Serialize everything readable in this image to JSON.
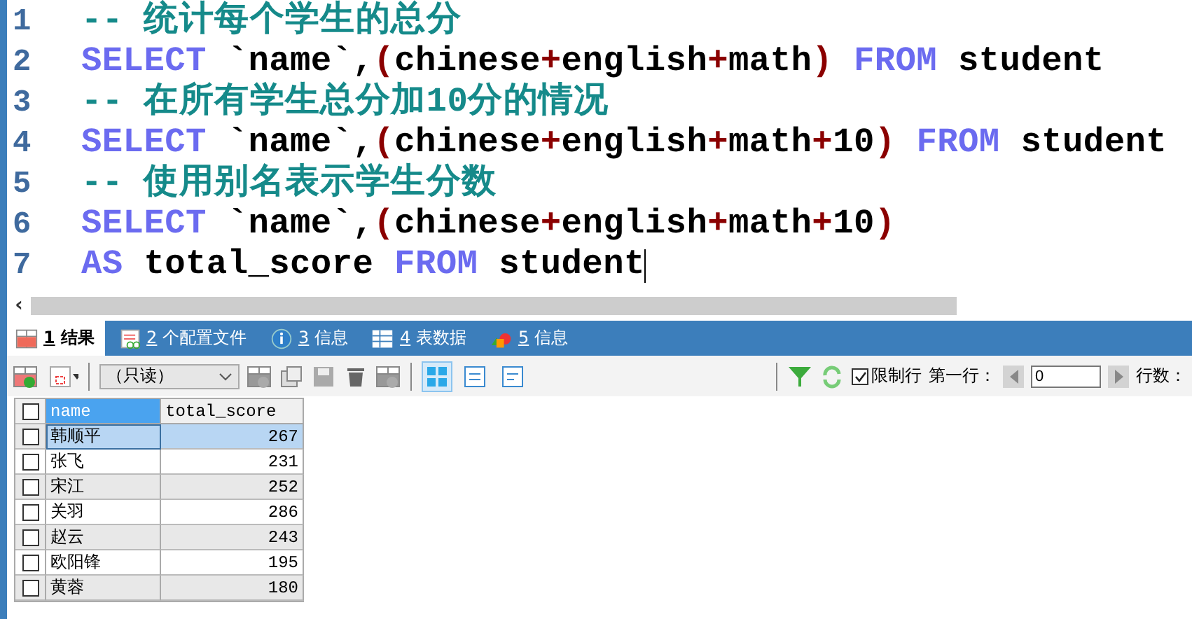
{
  "editor": {
    "lines": [
      {
        "number": "1",
        "tokens": [
          {
            "kind": "comment",
            "text": "-- 统计每个学生的总分"
          }
        ]
      },
      {
        "number": "2",
        "tokens": [
          {
            "kind": "keyword",
            "text": "SELECT"
          },
          {
            "kind": "plain",
            "text": " `name`,"
          },
          {
            "kind": "op",
            "text": "("
          },
          {
            "kind": "plain",
            "text": "chinese"
          },
          {
            "kind": "op",
            "text": "+"
          },
          {
            "kind": "plain",
            "text": "english"
          },
          {
            "kind": "op",
            "text": "+"
          },
          {
            "kind": "plain",
            "text": "math"
          },
          {
            "kind": "op",
            "text": ") "
          },
          {
            "kind": "keyword",
            "text": "FROM"
          },
          {
            "kind": "plain",
            "text": " student"
          }
        ]
      },
      {
        "number": "3",
        "tokens": [
          {
            "kind": "comment",
            "text": "-- 在所有学生总分加10分的情况"
          }
        ]
      },
      {
        "number": "4",
        "tokens": [
          {
            "kind": "keyword",
            "text": "SELECT"
          },
          {
            "kind": "plain",
            "text": " `name`,"
          },
          {
            "kind": "op",
            "text": "("
          },
          {
            "kind": "plain",
            "text": "chinese"
          },
          {
            "kind": "op",
            "text": "+"
          },
          {
            "kind": "plain",
            "text": "english"
          },
          {
            "kind": "op",
            "text": "+"
          },
          {
            "kind": "plain",
            "text": "math"
          },
          {
            "kind": "op",
            "text": "+"
          },
          {
            "kind": "plain",
            "text": "10"
          },
          {
            "kind": "op",
            "text": ") "
          },
          {
            "kind": "keyword",
            "text": "FROM"
          },
          {
            "kind": "plain",
            "text": " student"
          }
        ]
      },
      {
        "number": "5",
        "tokens": [
          {
            "kind": "comment",
            "text": "-- 使用别名表示学生分数"
          }
        ]
      },
      {
        "number": "6",
        "tokens": [
          {
            "kind": "keyword",
            "text": "SELECT"
          },
          {
            "kind": "plain",
            "text": " `name`,"
          },
          {
            "kind": "op",
            "text": "("
          },
          {
            "kind": "plain",
            "text": "chinese"
          },
          {
            "kind": "op",
            "text": "+"
          },
          {
            "kind": "plain",
            "text": "english"
          },
          {
            "kind": "op",
            "text": "+"
          },
          {
            "kind": "plain",
            "text": "math"
          },
          {
            "kind": "op",
            "text": "+"
          },
          {
            "kind": "plain",
            "text": "10"
          },
          {
            "kind": "op",
            "text": ")"
          }
        ]
      },
      {
        "number": "7",
        "tokens": [
          {
            "kind": "keyword",
            "text": "AS"
          },
          {
            "kind": "plain",
            "text": " total_score "
          },
          {
            "kind": "keyword",
            "text": "FROM"
          },
          {
            "kind": "plain",
            "text": " student"
          }
        ]
      }
    ],
    "scroll_left": "‹"
  },
  "tabs": [
    {
      "number": "1",
      "label": "结果",
      "kind": "grid",
      "selected": true
    },
    {
      "number": "2",
      "label": "个配置文件",
      "kind": "profile",
      "selected": false
    },
    {
      "number": "3",
      "label": "信息",
      "kind": "info",
      "selected": false
    },
    {
      "number": "4",
      "label": "表数据",
      "kind": "table",
      "selected": false
    },
    {
      "number": "5",
      "label": "信息",
      "kind": "shapes",
      "selected": false
    }
  ],
  "toolbar": {
    "mode": "（只读）",
    "views": [
      {
        "selected": true
      },
      {
        "selected": false
      },
      {
        "selected": false
      }
    ],
    "limit_rows": {
      "label": "限制行",
      "checked": true
    },
    "first_row_label": "第一行：",
    "first_row_value": "0",
    "row_count_label": "行数："
  },
  "grid": {
    "columns": [
      {
        "label": "name",
        "selected": true
      },
      {
        "label": "total_score",
        "selected": false
      }
    ],
    "rows": [
      {
        "name": "韩顺平",
        "total_score": "267",
        "selected": true,
        "checked": false
      },
      {
        "name": "张飞",
        "total_score": "231",
        "selected": false,
        "checked": false
      },
      {
        "name": "宋江",
        "total_score": "252",
        "selected": false,
        "checked": false
      },
      {
        "name": "关羽",
        "total_score": "286",
        "selected": false,
        "checked": false
      },
      {
        "name": "赵云",
        "total_score": "243",
        "selected": false,
        "checked": false
      },
      {
        "name": "欧阳锋",
        "total_score": "195",
        "selected": false,
        "checked": false
      },
      {
        "name": "黄蓉",
        "total_score": "180",
        "selected": false,
        "checked": false
      }
    ]
  }
}
